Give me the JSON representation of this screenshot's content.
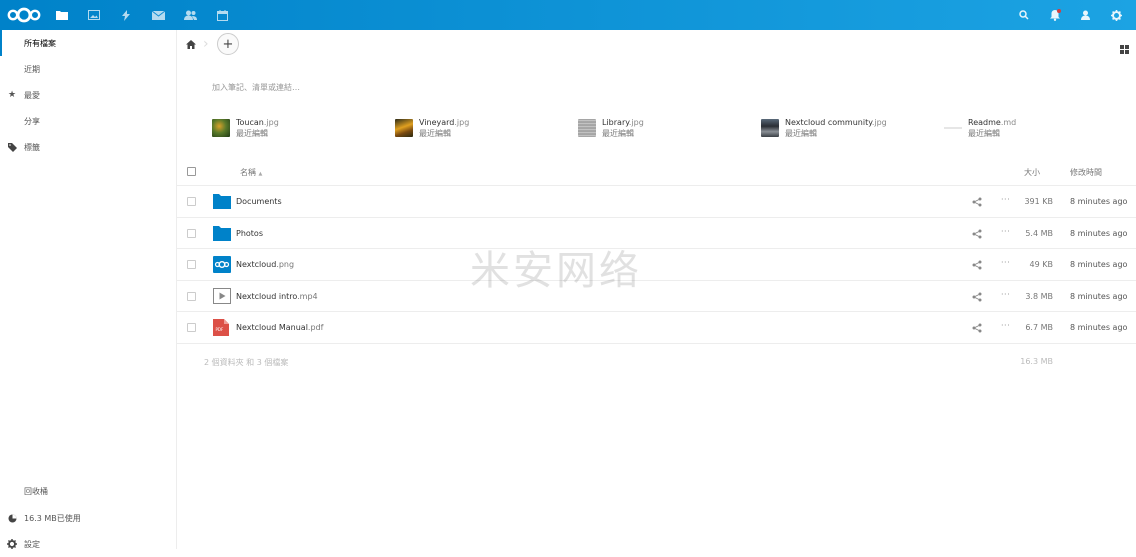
{
  "header": {
    "apps": [
      "files-icon",
      "gallery-icon",
      "activity-icon",
      "mail-icon",
      "contacts-icon",
      "calendar-icon"
    ],
    "right_icons": [
      "search-icon",
      "notifications-icon",
      "contacts-menu-icon",
      "settings-icon"
    ],
    "colors": {
      "accent": "#0082c9",
      "accent_light": "#1ca3e3"
    }
  },
  "sidebar": {
    "items": [
      {
        "label": "所有檔案",
        "icon": "folder-icon"
      },
      {
        "label": "近期",
        "icon": "clock-icon"
      },
      {
        "label": "最愛",
        "icon": "star-icon"
      },
      {
        "label": "分享",
        "icon": "share-icon"
      },
      {
        "label": "標籤",
        "icon": "tag-icon"
      }
    ],
    "trash_label": "回收桶",
    "quota_label": "16.3 MB已使用",
    "settings_label": "設定"
  },
  "breadcrumb": {
    "home_icon": "home-icon",
    "add_label": "+"
  },
  "description_placeholder": "加入筆記、清單或連結…",
  "recent": [
    {
      "name": "Toucan",
      "ext": ".jpg",
      "sub": "最近編輯"
    },
    {
      "name": "Vineyard",
      "ext": ".jpg",
      "sub": "最近編輯"
    },
    {
      "name": "Library",
      "ext": ".jpg",
      "sub": "最近編輯"
    },
    {
      "name": "Nextcloud community",
      "ext": ".jpg",
      "sub": "最近編輯"
    },
    {
      "name": "Readme",
      "ext": ".md",
      "sub": "最近編輯"
    }
  ],
  "table": {
    "col_name": "名稱",
    "sort_indicator": "▲",
    "col_size": "大小",
    "col_modified": "修改時間",
    "rows": [
      {
        "name": "Documents",
        "ext": "",
        "icon": "folder-icon",
        "size": "391 KB",
        "modified": "8 minutes ago"
      },
      {
        "name": "Photos",
        "ext": "",
        "icon": "folder-icon",
        "size": "5.4 MB",
        "modified": "8 minutes ago"
      },
      {
        "name": "Nextcloud",
        "ext": ".png",
        "icon": "nextcloud-image-icon",
        "size": "49 KB",
        "modified": "8 minutes ago"
      },
      {
        "name": "Nextcloud intro",
        "ext": ".mp4",
        "icon": "video-icon",
        "size": "3.8 MB",
        "modified": "8 minutes ago"
      },
      {
        "name": "Nextcloud Manual",
        "ext": ".pdf",
        "icon": "pdf-icon",
        "size": "6.7 MB",
        "modified": "8 minutes ago"
      }
    ],
    "more_label": "···",
    "summary_text": "2 個資料夾 和 3 個檔案",
    "summary_size": "16.3 MB"
  },
  "watermark": "米安网络"
}
